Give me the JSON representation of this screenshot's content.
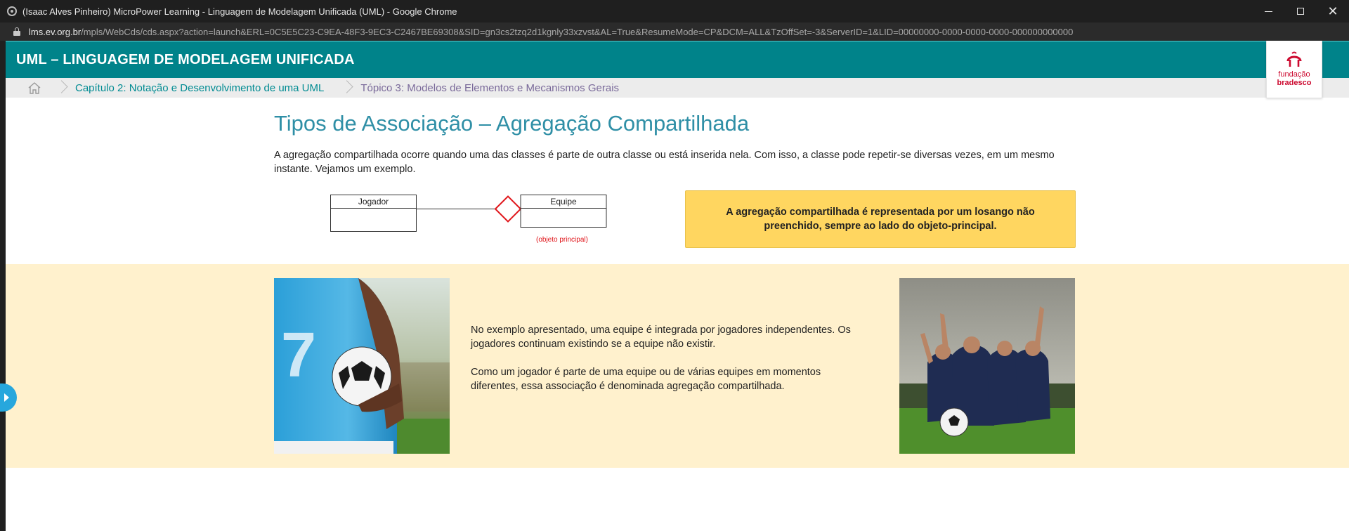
{
  "browser": {
    "window_title": "(Isaac Alves Pinheiro) MicroPower Learning - Linguagem de Modelagem Unificada (UML) - Google Chrome",
    "url_host": "lms.ev.org.br",
    "url_path": "/mpls/WebCds/cds.aspx?action=launch&ERL=0C5E5C23-C9EA-48F3-9EC3-C2467BE69308&SID=gn3cs2tzq2d1kgnly33xzvst&AL=True&ResumeMode=CP&DCM=ALL&TzOffSet=-3&ServerID=1&LID=00000000-0000-0000-0000-000000000000",
    "controls": {
      "minimize": "",
      "maximize": "",
      "close": "✕"
    }
  },
  "header": {
    "course_title": "UML – LINGUAGEM DE MODELAGEM UNIFICADA",
    "logo_line1": "fundação",
    "logo_line2": "bradesco"
  },
  "breadcrumb": {
    "chapter": "Capítulo 2: Notação e Desenvolvimento de uma UML",
    "topic": "Tópico 3: Modelos de Elementos e Mecanismos Gerais"
  },
  "content": {
    "title": "Tipos de Associação – Agregação Compartilhada",
    "intro": "A agregação compartilhada ocorre quando uma das classes é parte de outra classe ou está inserida nela. Com isso, a classe pode repetir-se diversas vezes, em um mesmo instante. Vejamos um exemplo.",
    "diagram": {
      "class_left": "Jogador",
      "class_right": "Equipe",
      "annotation": "(objeto principal)"
    },
    "callout": "A agregação compartilhada é representada por um losango não preenchido, sempre ao lado do objeto-principal.",
    "example_p1": "No exemplo apresentado, uma equipe é integrada por jogadores independentes. Os jogadores continuam existindo se a equipe não existir.",
    "example_p2": "Como um jogador é parte de uma equipe ou de várias equipes em momentos diferentes, essa associação é denominada agregação compartilhada.",
    "photo_left_jersey_number": "7"
  },
  "colors": {
    "header_bg": "#00838a",
    "title_color": "#2f8fa6",
    "callout_bg": "#ffd660",
    "band_bg": "#fff1cd",
    "diamond": "#e0161b",
    "brand_red": "#cc092f"
  }
}
